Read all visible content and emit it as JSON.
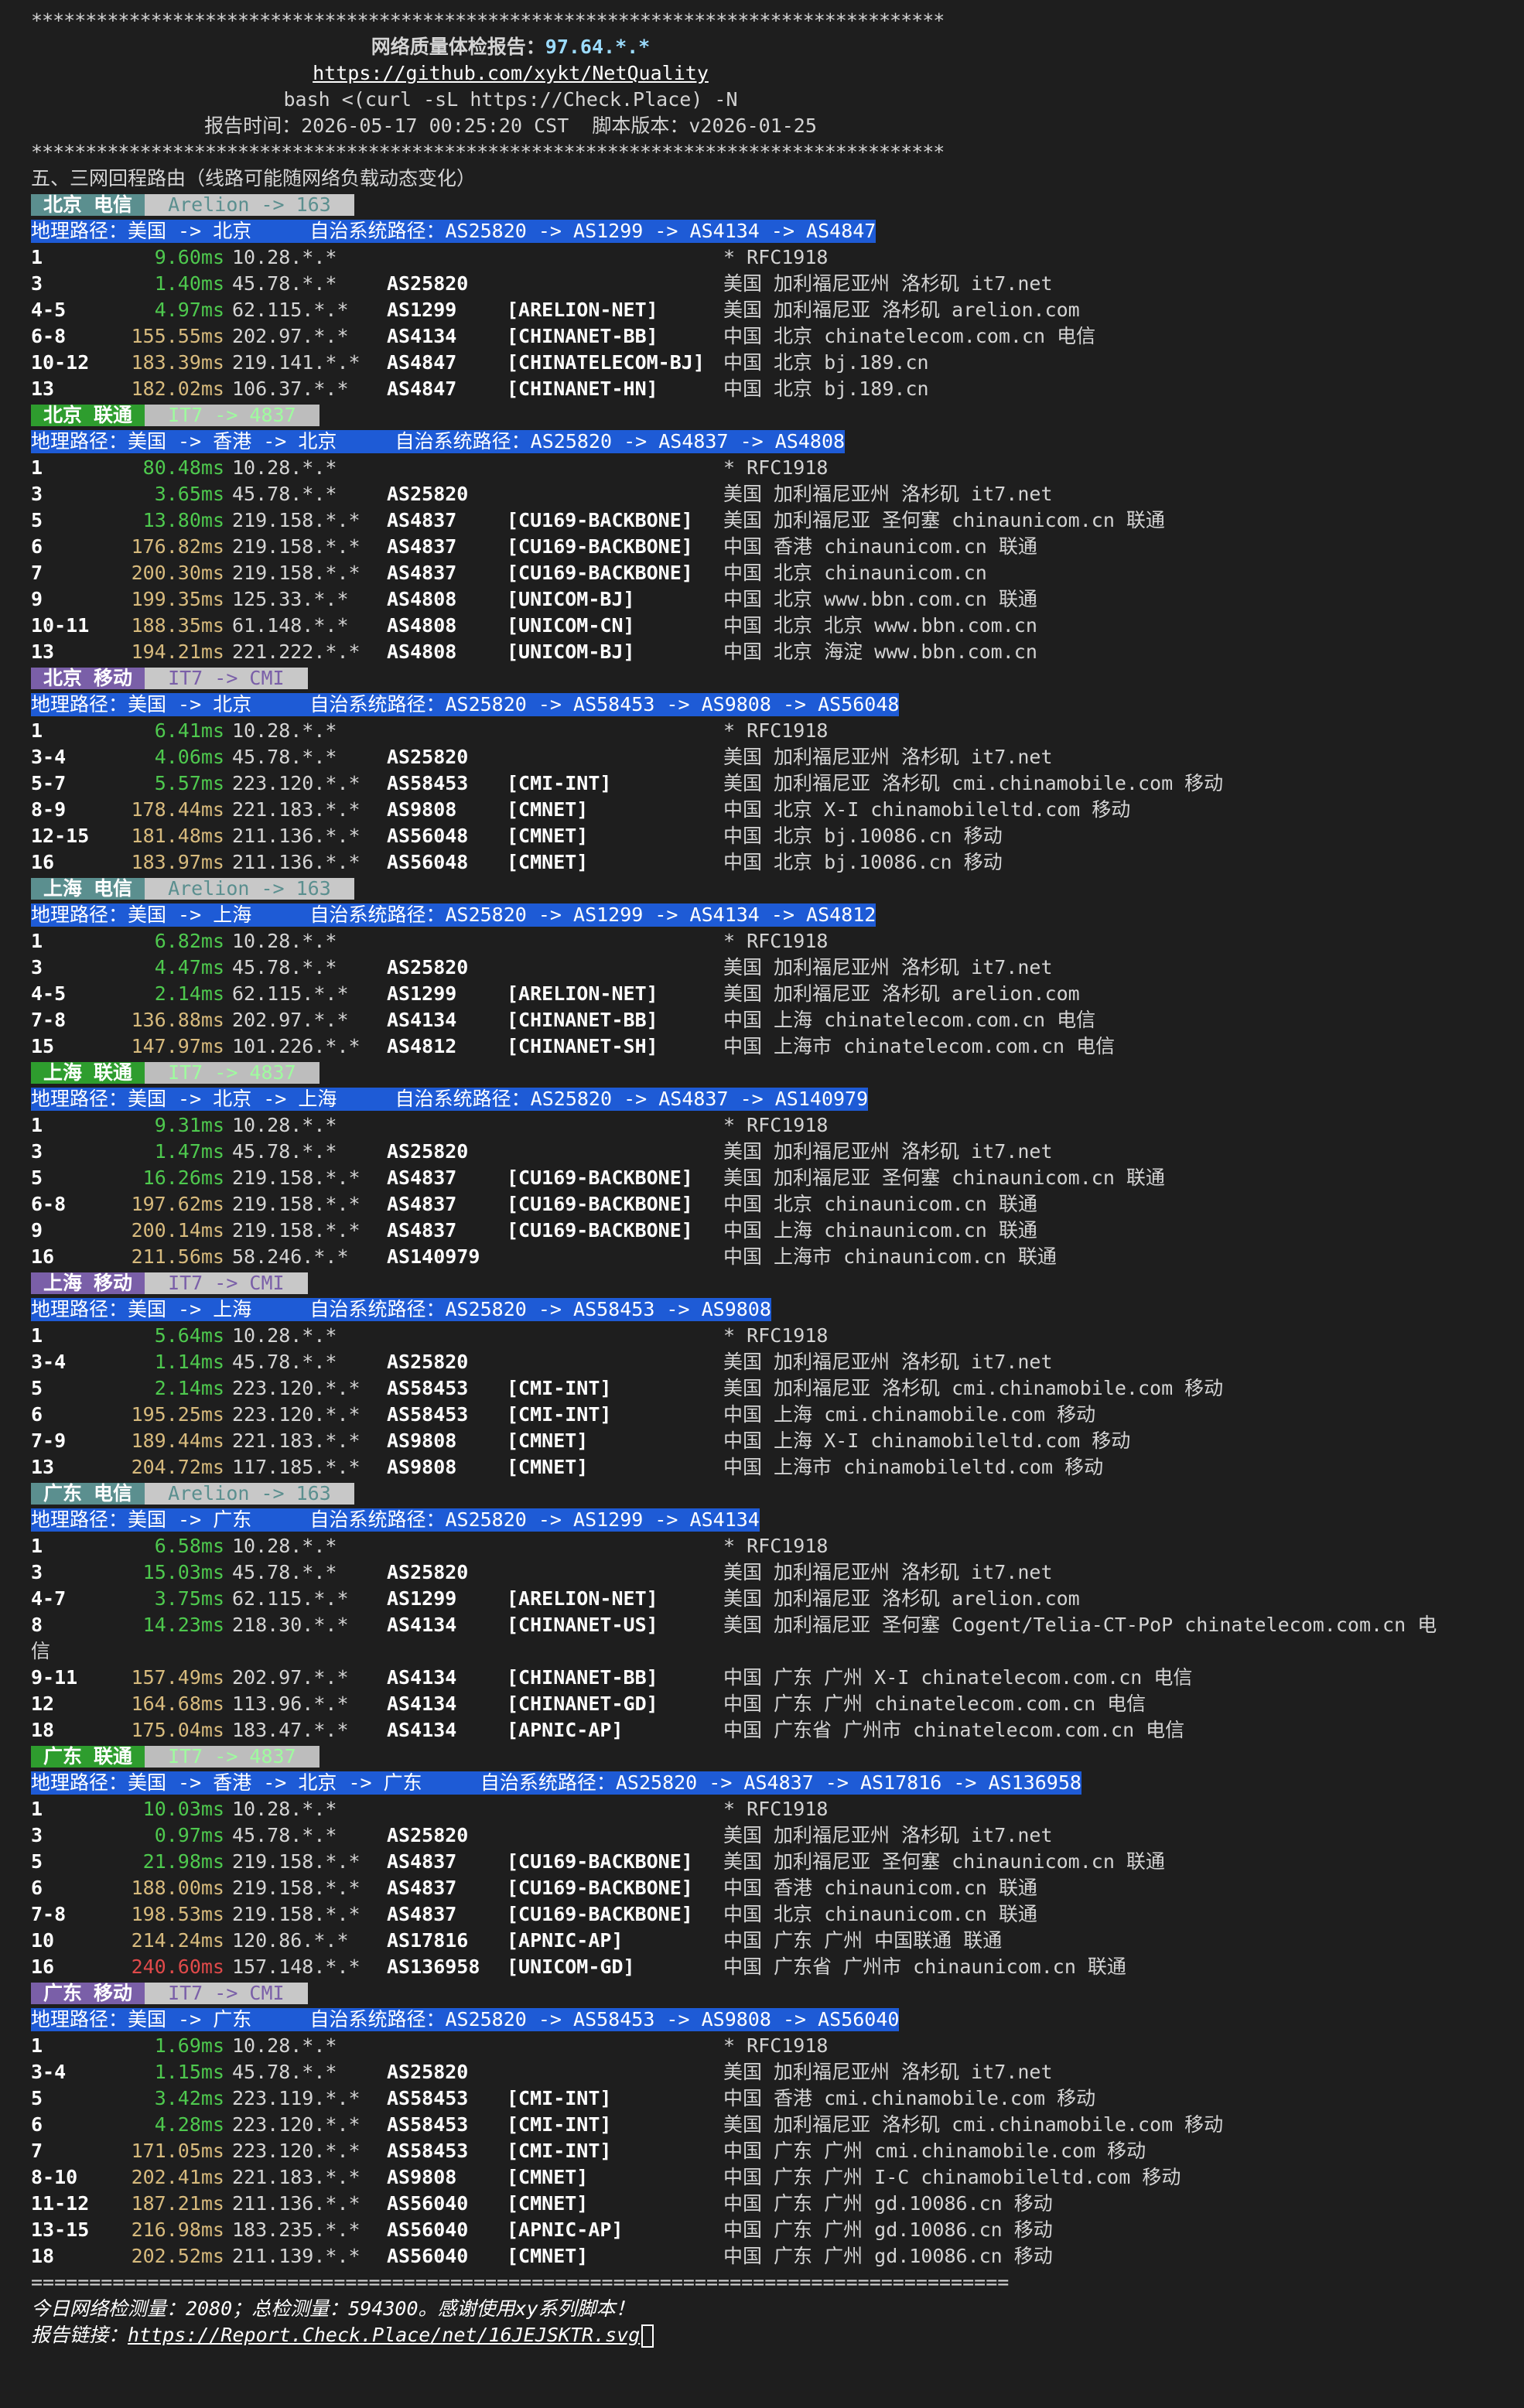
{
  "header": {
    "stars": "************************************************************************************",
    "title_label": "网络质量体检报告：",
    "title_ip": "97.64.*.*",
    "github": "https://github.com/xykt/NetQuality",
    "command": "bash <(curl -sL https://Check.Place) -N",
    "report_time": "报告时间：2026-05-17 00:25:20 CST  脚本版本：v2026-01-25"
  },
  "section_title": "五、三网回程路由（线路可能随网络负载动态变化）",
  "routes": [
    {
      "carrier": "ct",
      "title": "北京 电信",
      "sub": "Arelion -> 163",
      "path": "地理路径：美国 -> 北京     自治系统路径：AS25820 -> AS1299 -> AS4134 -> AS4847",
      "hops": [
        {
          "hop": "1",
          "ms": "9.60ms",
          "lvl": "g",
          "ip": "10.28.*.*",
          "asn": "",
          "tag": "",
          "geo": "* RFC1918"
        },
        {
          "hop": "3",
          "ms": "1.40ms",
          "lvl": "g",
          "ip": "45.78.*.*",
          "asn": "AS25820",
          "tag": "",
          "geo": "美国 加利福尼亚州 洛杉矶 it7.net"
        },
        {
          "hop": "4-5",
          "ms": "4.97ms",
          "lvl": "g",
          "ip": "62.115.*.*",
          "asn": "AS1299",
          "tag": "[ARELION-NET]",
          "geo": "美国 加利福尼亚 洛杉矶 arelion.com"
        },
        {
          "hop": "6-8",
          "ms": "155.55ms",
          "lvl": "y",
          "ip": "202.97.*.*",
          "asn": "AS4134",
          "tag": "[CHINANET-BB]",
          "geo": "中国 北京 chinatelecom.com.cn 电信"
        },
        {
          "hop": "10-12",
          "ms": "183.39ms",
          "lvl": "y",
          "ip": "219.141.*.*",
          "asn": "AS4847",
          "tag": "[CHINATELECOM-BJ]",
          "geo": "中国 北京 bj.189.cn"
        },
        {
          "hop": "13",
          "ms": "182.02ms",
          "lvl": "y",
          "ip": "106.37.*.*",
          "asn": "AS4847",
          "tag": "[CHINANET-HN]",
          "geo": "中国 北京 bj.189.cn"
        }
      ]
    },
    {
      "carrier": "cu",
      "title": "北京 联通",
      "sub": "IT7 -> 4837",
      "path": "地理路径：美国 -> 香港 -> 北京     自治系统路径：AS25820 -> AS4837 -> AS4808",
      "hops": [
        {
          "hop": "1",
          "ms": "80.48ms",
          "lvl": "g",
          "ip": "10.28.*.*",
          "asn": "",
          "tag": "",
          "geo": "* RFC1918"
        },
        {
          "hop": "3",
          "ms": "3.65ms",
          "lvl": "g",
          "ip": "45.78.*.*",
          "asn": "AS25820",
          "tag": "",
          "geo": "美国 加利福尼亚州 洛杉矶 it7.net"
        },
        {
          "hop": "5",
          "ms": "13.80ms",
          "lvl": "g",
          "ip": "219.158.*.*",
          "asn": "AS4837",
          "tag": "[CU169-BACKBONE]",
          "geo": "美国 加利福尼亚 圣何塞 chinaunicom.cn 联通"
        },
        {
          "hop": "6",
          "ms": "176.82ms",
          "lvl": "y",
          "ip": "219.158.*.*",
          "asn": "AS4837",
          "tag": "[CU169-BACKBONE]",
          "geo": "中国 香港 chinaunicom.cn 联通"
        },
        {
          "hop": "7",
          "ms": "200.30ms",
          "lvl": "y",
          "ip": "219.158.*.*",
          "asn": "AS4837",
          "tag": "[CU169-BACKBONE]",
          "geo": "中国 北京 chinaunicom.cn"
        },
        {
          "hop": "9",
          "ms": "199.35ms",
          "lvl": "y",
          "ip": "125.33.*.*",
          "asn": "AS4808",
          "tag": "[UNICOM-BJ]",
          "geo": "中国 北京 www.bbn.com.cn 联通"
        },
        {
          "hop": "10-11",
          "ms": "188.35ms",
          "lvl": "y",
          "ip": "61.148.*.*",
          "asn": "AS4808",
          "tag": "[UNICOM-CN]",
          "geo": "中国 北京 北京 www.bbn.com.cn"
        },
        {
          "hop": "13",
          "ms": "194.21ms",
          "lvl": "y",
          "ip": "221.222.*.*",
          "asn": "AS4808",
          "tag": "[UNICOM-BJ]",
          "geo": "中国 北京 海淀 www.bbn.com.cn"
        }
      ]
    },
    {
      "carrier": "cm",
      "title": "北京 移动",
      "sub": "IT7 -> CMI",
      "path": "地理路径：美国 -> 北京     自治系统路径：AS25820 -> AS58453 -> AS9808 -> AS56048",
      "hops": [
        {
          "hop": "1",
          "ms": "6.41ms",
          "lvl": "g",
          "ip": "10.28.*.*",
          "asn": "",
          "tag": "",
          "geo": "* RFC1918"
        },
        {
          "hop": "3-4",
          "ms": "4.06ms",
          "lvl": "g",
          "ip": "45.78.*.*",
          "asn": "AS25820",
          "tag": "",
          "geo": "美国 加利福尼亚州 洛杉矶 it7.net"
        },
        {
          "hop": "5-7",
          "ms": "5.57ms",
          "lvl": "g",
          "ip": "223.120.*.*",
          "asn": "AS58453",
          "tag": "[CMI-INT]",
          "geo": "美国 加利福尼亚 洛杉矶 cmi.chinamobile.com 移动"
        },
        {
          "hop": "8-9",
          "ms": "178.44ms",
          "lvl": "y",
          "ip": "221.183.*.*",
          "asn": "AS9808",
          "tag": "[CMNET]",
          "geo": "中国 北京 X-I chinamobileltd.com 移动"
        },
        {
          "hop": "12-15",
          "ms": "181.48ms",
          "lvl": "y",
          "ip": "211.136.*.*",
          "asn": "AS56048",
          "tag": "[CMNET]",
          "geo": "中国 北京 bj.10086.cn 移动"
        },
        {
          "hop": "16",
          "ms": "183.97ms",
          "lvl": "y",
          "ip": "211.136.*.*",
          "asn": "AS56048",
          "tag": "[CMNET]",
          "geo": "中国 北京 bj.10086.cn 移动"
        }
      ]
    },
    {
      "carrier": "ct",
      "title": "上海 电信",
      "sub": "Arelion -> 163",
      "path": "地理路径：美国 -> 上海     自治系统路径：AS25820 -> AS1299 -> AS4134 -> AS4812",
      "hops": [
        {
          "hop": "1",
          "ms": "6.82ms",
          "lvl": "g",
          "ip": "10.28.*.*",
          "asn": "",
          "tag": "",
          "geo": "* RFC1918"
        },
        {
          "hop": "3",
          "ms": "4.47ms",
          "lvl": "g",
          "ip": "45.78.*.*",
          "asn": "AS25820",
          "tag": "",
          "geo": "美国 加利福尼亚州 洛杉矶 it7.net"
        },
        {
          "hop": "4-5",
          "ms": "2.14ms",
          "lvl": "g",
          "ip": "62.115.*.*",
          "asn": "AS1299",
          "tag": "[ARELION-NET]",
          "geo": "美国 加利福尼亚 洛杉矶 arelion.com"
        },
        {
          "hop": "7-8",
          "ms": "136.88ms",
          "lvl": "y",
          "ip": "202.97.*.*",
          "asn": "AS4134",
          "tag": "[CHINANET-BB]",
          "geo": "中国 上海 chinatelecom.com.cn 电信"
        },
        {
          "hop": "15",
          "ms": "147.97ms",
          "lvl": "y",
          "ip": "101.226.*.*",
          "asn": "AS4812",
          "tag": "[CHINANET-SH]",
          "geo": "中国 上海市 chinatelecom.com.cn 电信"
        }
      ]
    },
    {
      "carrier": "cu",
      "title": "上海 联通",
      "sub": "IT7 -> 4837",
      "path": "地理路径：美国 -> 北京 -> 上海     自治系统路径：AS25820 -> AS4837 -> AS140979",
      "hops": [
        {
          "hop": "1",
          "ms": "9.31ms",
          "lvl": "g",
          "ip": "10.28.*.*",
          "asn": "",
          "tag": "",
          "geo": "* RFC1918"
        },
        {
          "hop": "3",
          "ms": "1.47ms",
          "lvl": "g",
          "ip": "45.78.*.*",
          "asn": "AS25820",
          "tag": "",
          "geo": "美国 加利福尼亚州 洛杉矶 it7.net"
        },
        {
          "hop": "5",
          "ms": "16.26ms",
          "lvl": "g",
          "ip": "219.158.*.*",
          "asn": "AS4837",
          "tag": "[CU169-BACKBONE]",
          "geo": "美国 加利福尼亚 圣何塞 chinaunicom.cn 联通"
        },
        {
          "hop": "6-8",
          "ms": "197.62ms",
          "lvl": "y",
          "ip": "219.158.*.*",
          "asn": "AS4837",
          "tag": "[CU169-BACKBONE]",
          "geo": "中国 北京 chinaunicom.cn 联通"
        },
        {
          "hop": "9",
          "ms": "200.14ms",
          "lvl": "y",
          "ip": "219.158.*.*",
          "asn": "AS4837",
          "tag": "[CU169-BACKBONE]",
          "geo": "中国 上海 chinaunicom.cn 联通"
        },
        {
          "hop": "16",
          "ms": "211.56ms",
          "lvl": "y",
          "ip": "58.246.*.*",
          "asn": "AS140979",
          "tag": "",
          "geo": "中国 上海市 chinaunicom.cn 联通"
        }
      ]
    },
    {
      "carrier": "cm",
      "title": "上海 移动",
      "sub": "IT7 -> CMI",
      "path": "地理路径：美国 -> 上海     自治系统路径：AS25820 -> AS58453 -> AS9808",
      "hops": [
        {
          "hop": "1",
          "ms": "5.64ms",
          "lvl": "g",
          "ip": "10.28.*.*",
          "asn": "",
          "tag": "",
          "geo": "* RFC1918"
        },
        {
          "hop": "3-4",
          "ms": "1.14ms",
          "lvl": "g",
          "ip": "45.78.*.*",
          "asn": "AS25820",
          "tag": "",
          "geo": "美国 加利福尼亚州 洛杉矶 it7.net"
        },
        {
          "hop": "5",
          "ms": "2.14ms",
          "lvl": "g",
          "ip": "223.120.*.*",
          "asn": "AS58453",
          "tag": "[CMI-INT]",
          "geo": "美国 加利福尼亚 洛杉矶 cmi.chinamobile.com 移动"
        },
        {
          "hop": "6",
          "ms": "195.25ms",
          "lvl": "y",
          "ip": "223.120.*.*",
          "asn": "AS58453",
          "tag": "[CMI-INT]",
          "geo": "中国 上海 cmi.chinamobile.com 移动"
        },
        {
          "hop": "7-9",
          "ms": "189.44ms",
          "lvl": "y",
          "ip": "221.183.*.*",
          "asn": "AS9808",
          "tag": "[CMNET]",
          "geo": "中国 上海 X-I chinamobileltd.com 移动"
        },
        {
          "hop": "13",
          "ms": "204.72ms",
          "lvl": "y",
          "ip": "117.185.*.*",
          "asn": "AS9808",
          "tag": "[CMNET]",
          "geo": "中国 上海市 chinamobileltd.com 移动"
        }
      ]
    },
    {
      "carrier": "ct",
      "title": "广东 电信",
      "sub": "Arelion -> 163",
      "path": "地理路径：美国 -> 广东     自治系统路径：AS25820 -> AS1299 -> AS4134",
      "hops": [
        {
          "hop": "1",
          "ms": "6.58ms",
          "lvl": "g",
          "ip": "10.28.*.*",
          "asn": "",
          "tag": "",
          "geo": "* RFC1918"
        },
        {
          "hop": "3",
          "ms": "15.03ms",
          "lvl": "g",
          "ip": "45.78.*.*",
          "asn": "AS25820",
          "tag": "",
          "geo": "美国 加利福尼亚州 洛杉矶 it7.net"
        },
        {
          "hop": "4-7",
          "ms": "3.75ms",
          "lvl": "g",
          "ip": "62.115.*.*",
          "asn": "AS1299",
          "tag": "[ARELION-NET]",
          "geo": "美国 加利福尼亚 洛杉矶 arelion.com"
        },
        {
          "hop": "8",
          "ms": "14.23ms",
          "lvl": "g",
          "ip": "218.30.*.*",
          "asn": "AS4134",
          "tag": "[CHINANET-US]",
          "geo": "美国 加利福尼亚 圣何塞 Cogent/Telia-CT-PoP chinatelecom.com.cn 电",
          "wrap": "信"
        },
        {
          "hop": "9-11",
          "ms": "157.49ms",
          "lvl": "y",
          "ip": "202.97.*.*",
          "asn": "AS4134",
          "tag": "[CHINANET-BB]",
          "geo": "中国 广东 广州 X-I chinatelecom.com.cn 电信"
        },
        {
          "hop": "12",
          "ms": "164.68ms",
          "lvl": "y",
          "ip": "113.96.*.*",
          "asn": "AS4134",
          "tag": "[CHINANET-GD]",
          "geo": "中国 广东 广州 chinatelecom.com.cn 电信"
        },
        {
          "hop": "18",
          "ms": "175.04ms",
          "lvl": "y",
          "ip": "183.47.*.*",
          "asn": "AS4134",
          "tag": "[APNIC-AP]",
          "geo": "中国 广东省 广州市 chinatelecom.com.cn 电信"
        }
      ]
    },
    {
      "carrier": "cu",
      "title": "广东 联通",
      "sub": "IT7 -> 4837",
      "path": "地理路径：美国 -> 香港 -> 北京 -> 广东     自治系统路径：AS25820 -> AS4837 -> AS17816 -> AS136958",
      "hops": [
        {
          "hop": "1",
          "ms": "10.03ms",
          "lvl": "g",
          "ip": "10.28.*.*",
          "asn": "",
          "tag": "",
          "geo": "* RFC1918"
        },
        {
          "hop": "3",
          "ms": "0.97ms",
          "lvl": "g",
          "ip": "45.78.*.*",
          "asn": "AS25820",
          "tag": "",
          "geo": "美国 加利福尼亚州 洛杉矶 it7.net"
        },
        {
          "hop": "5",
          "ms": "21.98ms",
          "lvl": "g",
          "ip": "219.158.*.*",
          "asn": "AS4837",
          "tag": "[CU169-BACKBONE]",
          "geo": "美国 加利福尼亚 圣何塞 chinaunicom.cn 联通"
        },
        {
          "hop": "6",
          "ms": "188.00ms",
          "lvl": "y",
          "ip": "219.158.*.*",
          "asn": "AS4837",
          "tag": "[CU169-BACKBONE]",
          "geo": "中国 香港 chinaunicom.cn 联通"
        },
        {
          "hop": "7-8",
          "ms": "198.53ms",
          "lvl": "y",
          "ip": "219.158.*.*",
          "asn": "AS4837",
          "tag": "[CU169-BACKBONE]",
          "geo": "中国 北京 chinaunicom.cn 联通"
        },
        {
          "hop": "10",
          "ms": "214.24ms",
          "lvl": "y",
          "ip": "120.86.*.*",
          "asn": "AS17816",
          "tag": "[APNIC-AP]",
          "geo": "中国 广东 广州 中国联通 联通"
        },
        {
          "hop": "16",
          "ms": "240.60ms",
          "lvl": "r",
          "ip": "157.148.*.*",
          "asn": "AS136958",
          "tag": "[UNICOM-GD]",
          "geo": "中国 广东省 广州市 chinaunicom.cn 联通"
        }
      ]
    },
    {
      "carrier": "cm",
      "title": "广东 移动",
      "sub": "IT7 -> CMI",
      "path": "地理路径：美国 -> 广东     自治系统路径：AS25820 -> AS58453 -> AS9808 -> AS56040",
      "hops": [
        {
          "hop": "1",
          "ms": "1.69ms",
          "lvl": "g",
          "ip": "10.28.*.*",
          "asn": "",
          "tag": "",
          "geo": "* RFC1918"
        },
        {
          "hop": "3-4",
          "ms": "1.15ms",
          "lvl": "g",
          "ip": "45.78.*.*",
          "asn": "AS25820",
          "tag": "",
          "geo": "美国 加利福尼亚州 洛杉矶 it7.net"
        },
        {
          "hop": "5",
          "ms": "3.42ms",
          "lvl": "g",
          "ip": "223.119.*.*",
          "asn": "AS58453",
          "tag": "[CMI-INT]",
          "geo": "中国 香港 cmi.chinamobile.com 移动"
        },
        {
          "hop": "6",
          "ms": "4.28ms",
          "lvl": "g",
          "ip": "223.120.*.*",
          "asn": "AS58453",
          "tag": "[CMI-INT]",
          "geo": "美国 加利福尼亚 洛杉矶 cmi.chinamobile.com 移动"
        },
        {
          "hop": "7",
          "ms": "171.05ms",
          "lvl": "y",
          "ip": "223.120.*.*",
          "asn": "AS58453",
          "tag": "[CMI-INT]",
          "geo": "中国 广东 广州 cmi.chinamobile.com 移动"
        },
        {
          "hop": "8-10",
          "ms": "202.41ms",
          "lvl": "y",
          "ip": "221.183.*.*",
          "asn": "AS9808",
          "tag": "[CMNET]",
          "geo": "中国 广东 广州 I-C chinamobileltd.com 移动"
        },
        {
          "hop": "11-12",
          "ms": "187.21ms",
          "lvl": "y",
          "ip": "211.136.*.*",
          "asn": "AS56040",
          "tag": "[CMNET]",
          "geo": "中国 广东 广州 gd.10086.cn 移动"
        },
        {
          "hop": "13-15",
          "ms": "216.98ms",
          "lvl": "y",
          "ip": "183.235.*.*",
          "asn": "AS56040",
          "tag": "[APNIC-AP]",
          "geo": "中国 广东 广州 gd.10086.cn 移动"
        },
        {
          "hop": "18",
          "ms": "202.52ms",
          "lvl": "y",
          "ip": "211.139.*.*",
          "asn": "AS56040",
          "tag": "[CMNET]",
          "geo": "中国 广东 广州 gd.10086.cn 移动"
        }
      ]
    }
  ],
  "footer": {
    "rule": "====================================================================================",
    "stats": "今日网络检测量：2080；总检测量：594300。感谢使用xy系列脚本！",
    "report_label": "报告链接：",
    "report_url": "https://Report.Check.Place/net/16JEJSKTR.svg"
  }
}
